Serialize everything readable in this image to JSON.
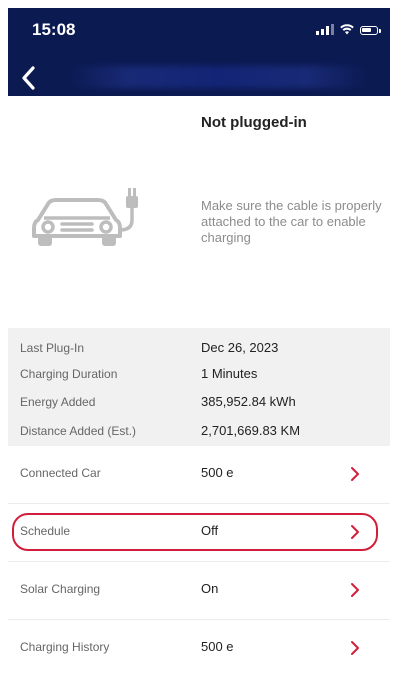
{
  "status_bar": {
    "time": "15:08"
  },
  "header": {
    "back_icon": "chevron-left-icon"
  },
  "plug": {
    "status": "Not plugged-in",
    "hint": "Make sure the cable is properly attached to the car to enable charging",
    "illustration": "car-with-plug-icon"
  },
  "stats": [
    {
      "label": "Last Plug-In",
      "value": "Dec 26, 2023"
    },
    {
      "label": "Charging Duration",
      "value": "1 Minutes"
    },
    {
      "label": "Energy Added",
      "value": "385,952.84 kWh"
    },
    {
      "label": "Distance Added (Est.)",
      "value": "2,701,669.83 KM"
    }
  ],
  "menu": [
    {
      "label": "Connected Car",
      "value": "500 e"
    },
    {
      "label": "Schedule",
      "value": "Off"
    },
    {
      "label": "Solar Charging",
      "value": "On"
    },
    {
      "label": "Charging History",
      "value": "500 e"
    }
  ],
  "colors": {
    "header_bg": "#0c1a52",
    "accent_red": "#d21e3a",
    "stats_bg": "#f1f1f1",
    "muted_text": "#8c8c8c"
  }
}
